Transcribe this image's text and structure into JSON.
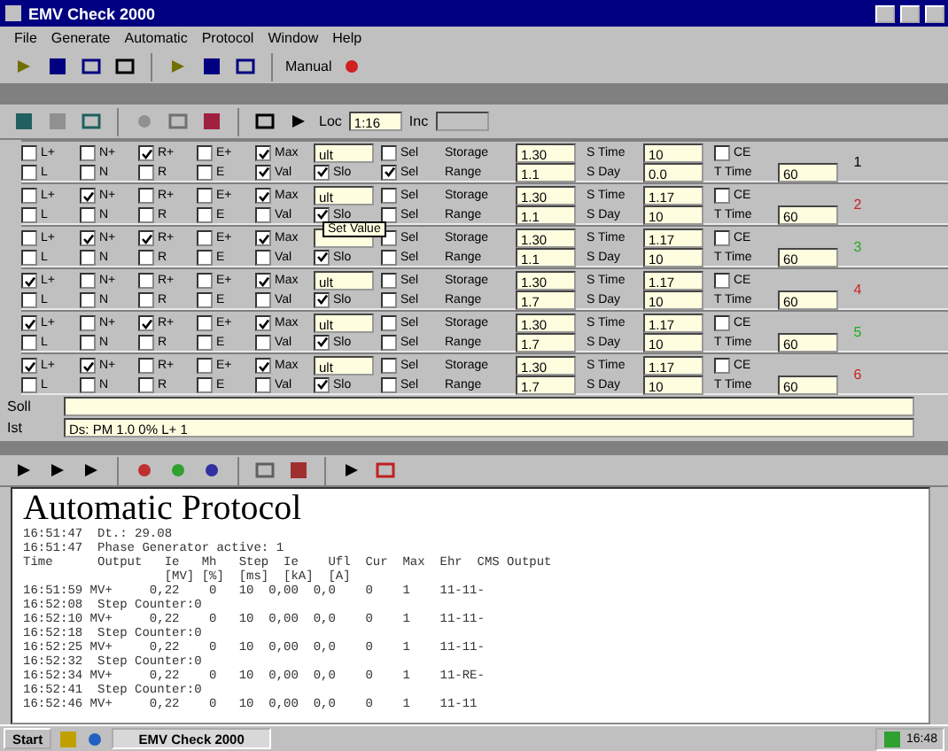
{
  "window": {
    "title": "EMV Check 2000"
  },
  "menu": [
    "File",
    "Generate",
    "Automatic",
    "Protocol",
    "Window",
    "Help"
  ],
  "toolbar": {
    "mode_label": "Manual"
  },
  "panel_toolbar": {
    "loc_label": "Loc",
    "loc_value": "1:16",
    "inc_label": "Inc"
  },
  "rows": [
    {
      "marker": "1",
      "color": "#000000",
      "lines": [
        [
          {
            "kind": "check",
            "label": "L+",
            "checked": false
          },
          {
            "kind": "check",
            "label": "N+",
            "checked": false
          },
          {
            "kind": "check",
            "label": "R+",
            "checked": true
          },
          {
            "kind": "check",
            "label": "E+",
            "checked": false
          },
          {
            "kind": "check",
            "label": "Max",
            "checked": true
          },
          {
            "kind": "field",
            "value": "ult"
          },
          {
            "kind": "check",
            "label": "Sel",
            "checked": false
          },
          {
            "kind": "label",
            "text": "Storage"
          },
          {
            "kind": "field",
            "value": "1.30"
          },
          {
            "kind": "label",
            "text": "S Time"
          },
          {
            "kind": "field",
            "value": "10"
          },
          {
            "kind": "check",
            "label": "CE",
            "checked": false
          }
        ],
        [
          {
            "kind": "check",
            "label": "L",
            "checked": false
          },
          {
            "kind": "check",
            "label": "N",
            "checked": false
          },
          {
            "kind": "check",
            "label": "R",
            "checked": false
          },
          {
            "kind": "check",
            "label": "E",
            "checked": false
          },
          {
            "kind": "check",
            "label": "Val",
            "checked": true
          },
          {
            "kind": "check",
            "label": "Slo",
            "checked": true
          },
          {
            "kind": "check",
            "label": "Sel",
            "checked": true
          },
          {
            "kind": "label",
            "text": "Range"
          },
          {
            "kind": "field",
            "value": "1.1"
          },
          {
            "kind": "label",
            "text": "S Day"
          },
          {
            "kind": "field",
            "value": "0.0"
          },
          {
            "kind": "label",
            "text": "T Time"
          },
          {
            "kind": "field",
            "value": "60"
          }
        ]
      ]
    },
    {
      "marker": "2",
      "color": "#cc2222",
      "lines": [
        [
          {
            "kind": "check",
            "label": "L+",
            "checked": false
          },
          {
            "kind": "check",
            "label": "N+",
            "checked": true
          },
          {
            "kind": "check",
            "label": "R+",
            "checked": false
          },
          {
            "kind": "check",
            "label": "E+",
            "checked": false
          },
          {
            "kind": "check",
            "label": "Max",
            "checked": true
          },
          {
            "kind": "field",
            "value": "ult"
          },
          {
            "kind": "check",
            "label": "Sel",
            "checked": false
          },
          {
            "kind": "label",
            "text": "Storage"
          },
          {
            "kind": "field",
            "value": "1.30"
          },
          {
            "kind": "label",
            "text": "S Time"
          },
          {
            "kind": "field",
            "value": "1.17"
          },
          {
            "kind": "check",
            "label": "CE",
            "checked": false
          }
        ],
        [
          {
            "kind": "check",
            "label": "L",
            "checked": false
          },
          {
            "kind": "check",
            "label": "N",
            "checked": false
          },
          {
            "kind": "check",
            "label": "R",
            "checked": false
          },
          {
            "kind": "check",
            "label": "E",
            "checked": false
          },
          {
            "kind": "check",
            "label": "Val",
            "checked": false
          },
          {
            "kind": "check",
            "label": "Slo",
            "checked": true
          },
          {
            "kind": "check",
            "label": "Sel",
            "checked": false
          },
          {
            "kind": "label",
            "text": "Range"
          },
          {
            "kind": "field",
            "value": "1.1"
          },
          {
            "kind": "label",
            "text": "S Day"
          },
          {
            "kind": "field",
            "value": "10"
          },
          {
            "kind": "label",
            "text": "T Time"
          },
          {
            "kind": "field",
            "value": "60"
          }
        ]
      ]
    },
    {
      "marker": "3",
      "color": "#22aa22",
      "lines": [
        [
          {
            "kind": "check",
            "label": "L+",
            "checked": false
          },
          {
            "kind": "check",
            "label": "N+",
            "checked": true
          },
          {
            "kind": "check",
            "label": "R+",
            "checked": true
          },
          {
            "kind": "check",
            "label": "E+",
            "checked": false
          },
          {
            "kind": "check",
            "label": "Max",
            "checked": true
          },
          {
            "kind": "field"
          },
          {
            "kind": "check",
            "label": "Sel",
            "checked": false
          },
          {
            "kind": "label",
            "text": "Storage"
          },
          {
            "kind": "field",
            "value": "1.30"
          },
          {
            "kind": "label",
            "text": "S Time"
          },
          {
            "kind": "field",
            "value": "1.17"
          },
          {
            "kind": "check",
            "label": "CE",
            "checked": false
          }
        ],
        [
          {
            "kind": "check",
            "label": "L",
            "checked": false
          },
          {
            "kind": "check",
            "label": "N",
            "checked": false
          },
          {
            "kind": "check",
            "label": "R",
            "checked": false
          },
          {
            "kind": "check",
            "label": "E",
            "checked": false
          },
          {
            "kind": "check",
            "label": "Val",
            "checked": false
          },
          {
            "kind": "check",
            "label": "Slo",
            "checked": true
          },
          {
            "kind": "check",
            "label": "Sel",
            "checked": false
          },
          {
            "kind": "label",
            "text": "Range"
          },
          {
            "kind": "field",
            "value": "1.1"
          },
          {
            "kind": "label",
            "text": "S Day"
          },
          {
            "kind": "field",
            "value": "10"
          },
          {
            "kind": "label",
            "text": "T Time"
          },
          {
            "kind": "field",
            "value": "60"
          }
        ]
      ]
    },
    {
      "marker": "4",
      "color": "#cc2222",
      "lines": [
        [
          {
            "kind": "check",
            "label": "L+",
            "checked": true
          },
          {
            "kind": "check",
            "label": "N+",
            "checked": false
          },
          {
            "kind": "check",
            "label": "R+",
            "checked": false
          },
          {
            "kind": "check",
            "label": "E+",
            "checked": false
          },
          {
            "kind": "check",
            "label": "Max",
            "checked": true
          },
          {
            "kind": "field",
            "value": "ult"
          },
          {
            "kind": "check",
            "label": "Sel",
            "checked": false
          },
          {
            "kind": "label",
            "text": "Storage"
          },
          {
            "kind": "field",
            "value": "1.30"
          },
          {
            "kind": "label",
            "text": "S Time"
          },
          {
            "kind": "field",
            "value": "1.17"
          },
          {
            "kind": "check",
            "label": "CE",
            "checked": false
          }
        ],
        [
          {
            "kind": "check",
            "label": "L",
            "checked": false
          },
          {
            "kind": "check",
            "label": "N",
            "checked": false
          },
          {
            "kind": "check",
            "label": "R",
            "checked": false
          },
          {
            "kind": "check",
            "label": "E",
            "checked": false
          },
          {
            "kind": "check",
            "label": "Val",
            "checked": false
          },
          {
            "kind": "check",
            "label": "Slo",
            "checked": true
          },
          {
            "kind": "check",
            "label": "Sel",
            "checked": false
          },
          {
            "kind": "label",
            "text": "Range"
          },
          {
            "kind": "field",
            "value": "1.7"
          },
          {
            "kind": "label",
            "text": "S Day"
          },
          {
            "kind": "field",
            "value": "10"
          },
          {
            "kind": "label",
            "text": "T Time"
          },
          {
            "kind": "field",
            "value": "60"
          }
        ]
      ]
    },
    {
      "marker": "5",
      "color": "#22aa22",
      "lines": [
        [
          {
            "kind": "check",
            "label": "L+",
            "checked": true
          },
          {
            "kind": "check",
            "label": "N+",
            "checked": false
          },
          {
            "kind": "check",
            "label": "R+",
            "checked": true
          },
          {
            "kind": "check",
            "label": "E+",
            "checked": false
          },
          {
            "kind": "check",
            "label": "Max",
            "checked": true
          },
          {
            "kind": "field",
            "value": "ult"
          },
          {
            "kind": "check",
            "label": "Sel",
            "checked": false
          },
          {
            "kind": "label",
            "text": "Storage"
          },
          {
            "kind": "field",
            "value": "1.30"
          },
          {
            "kind": "label",
            "text": "S Time"
          },
          {
            "kind": "field",
            "value": "1.17"
          },
          {
            "kind": "check",
            "label": "CE",
            "checked": false
          }
        ],
        [
          {
            "kind": "check",
            "label": "L",
            "checked": false
          },
          {
            "kind": "check",
            "label": "N",
            "checked": false
          },
          {
            "kind": "check",
            "label": "R",
            "checked": false
          },
          {
            "kind": "check",
            "label": "E",
            "checked": false
          },
          {
            "kind": "check",
            "label": "Val",
            "checked": false
          },
          {
            "kind": "check",
            "label": "Slo",
            "checked": true
          },
          {
            "kind": "check",
            "label": "Sel",
            "checked": false
          },
          {
            "kind": "label",
            "text": "Range"
          },
          {
            "kind": "field",
            "value": "1.7"
          },
          {
            "kind": "label",
            "text": "S Day"
          },
          {
            "kind": "field",
            "value": "10"
          },
          {
            "kind": "label",
            "text": "T Time"
          },
          {
            "kind": "field",
            "value": "60"
          }
        ]
      ]
    },
    {
      "marker": "6",
      "color": "#cc2222",
      "lines": [
        [
          {
            "kind": "check",
            "label": "L+",
            "checked": true
          },
          {
            "kind": "check",
            "label": "N+",
            "checked": true
          },
          {
            "kind": "check",
            "label": "R+",
            "checked": false
          },
          {
            "kind": "check",
            "label": "E+",
            "checked": false
          },
          {
            "kind": "check",
            "label": "Max",
            "checked": true
          },
          {
            "kind": "field",
            "value": "ult"
          },
          {
            "kind": "check",
            "label": "Sel",
            "checked": false
          },
          {
            "kind": "label",
            "text": "Storage"
          },
          {
            "kind": "field",
            "value": "1.30"
          },
          {
            "kind": "label",
            "text": "S Time"
          },
          {
            "kind": "field",
            "value": "1.17"
          },
          {
            "kind": "check",
            "label": "CE",
            "checked": false
          }
        ],
        [
          {
            "kind": "check",
            "label": "L",
            "checked": false
          },
          {
            "kind": "check",
            "label": "N",
            "checked": false
          },
          {
            "kind": "check",
            "label": "R",
            "checked": false
          },
          {
            "kind": "check",
            "label": "E",
            "checked": false
          },
          {
            "kind": "check",
            "label": "Val",
            "checked": false
          },
          {
            "kind": "check",
            "label": "Slo",
            "checked": true
          },
          {
            "kind": "check",
            "label": "Sel",
            "checked": false
          },
          {
            "kind": "label",
            "text": "Range"
          },
          {
            "kind": "field",
            "value": "1.7"
          },
          {
            "kind": "label",
            "text": "S Day"
          },
          {
            "kind": "field",
            "value": "10"
          },
          {
            "kind": "label",
            "text": "T Time"
          },
          {
            "kind": "field",
            "value": "60"
          }
        ]
      ]
    }
  ],
  "tooltip": "Set Value",
  "soll": {
    "label": "Soll"
  },
  "ist": {
    "label": "Ist",
    "value": "Ds: PM 1.0 0% L+ 1"
  },
  "protocol": {
    "title": "Automatic Protocol",
    "lines": [
      "16:51:47  Dt.: 29.08",
      "16:51:47  Phase Generator active: 1",
      "Time      Output   Ie   Mh   Step  Ie    Ufl  Cur  Max  Ehr  CMS Output",
      "                   [MV] [%]  [ms]  [kA]  [A]",
      "16:51:59 MV+     0,22    0   10  0,00  0,0    0    1    11-11-",
      "16:52:08  Step Counter:0",
      "16:52:10 MV+     0,22    0   10  0,00  0,0    0    1    11-11-",
      "16:52:18  Step Counter:0",
      "16:52:25 MV+     0,22    0   10  0,00  0,0    0    1    11-11-",
      "16:52:32  Step Counter:0",
      "16:52:34 MV+     0,22    0   10  0,00  0,0    0    1    11-RE-",
      "16:52:41  Step Counter:0",
      "16:52:46 MV+     0,22    0   10  0,00  0,0    0    1    11-11"
    ]
  },
  "taskbar": {
    "start": "Start",
    "task": "EMV Check 2000",
    "clock": "16:48"
  }
}
